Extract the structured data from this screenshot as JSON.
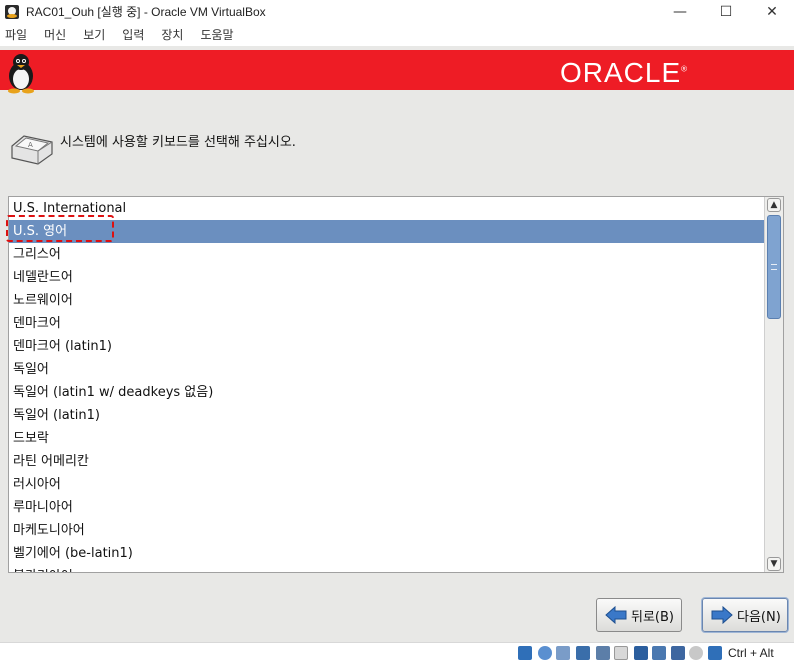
{
  "window": {
    "title": "RAC01_Ouh [실행 중] - Oracle VM VirtualBox",
    "minimize": "—",
    "maximize": "☐",
    "close": "✕"
  },
  "menu": [
    "파일",
    "머신",
    "보기",
    "입력",
    "장치",
    "도움말"
  ],
  "banner": {
    "logo_text": "ORACLE",
    "brand_color": "#ee1c25"
  },
  "prompt": "시스템에 사용할 키보드를 선택해 주십시오.",
  "keyboard_list": {
    "selected_index": 1,
    "items": [
      "U.S. International",
      "U.S. 영어",
      "그리스어",
      "네델란드어",
      "노르웨이어",
      "덴마크어",
      "덴마크어 (latin1)",
      "독일어",
      "독일어 (latin1 w/ deadkeys 없음)",
      "독일어 (latin1)",
      "드보락",
      "라틴 어메리칸",
      "러시아어",
      "루마니아어",
      "마케도니아어",
      "벨기에어 (be-latin1)",
      "불가리아어"
    ]
  },
  "buttons": {
    "back": "뒤로(B)",
    "next": "다음(N)"
  },
  "statusbar": {
    "host_key": "Ctrl + Alt"
  }
}
